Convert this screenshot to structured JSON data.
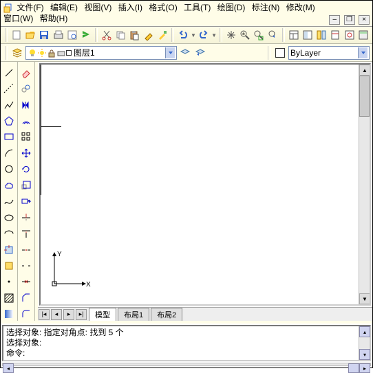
{
  "menu": {
    "file": "文件(F)",
    "edit": "编辑(E)",
    "view": "视图(V)",
    "insert": "插入(I)",
    "format": "格式(O)",
    "tools": "工具(T)",
    "draw": "绘图(D)",
    "dimension": "标注(N)",
    "modify": "修改(M)",
    "window": "窗口(W)",
    "help": "帮助(H)"
  },
  "layerbar": {
    "current_layer": "图层1",
    "linetype": "ByLayer"
  },
  "canvas": {
    "x_label": "X",
    "y_label": "Y"
  },
  "tabs": [
    "模型",
    "布局1",
    "布局2"
  ],
  "command": {
    "line1": "选择对象: 指定对角点: 找到 5 个",
    "line2": "选择对象:",
    "prompt": "命令:"
  }
}
